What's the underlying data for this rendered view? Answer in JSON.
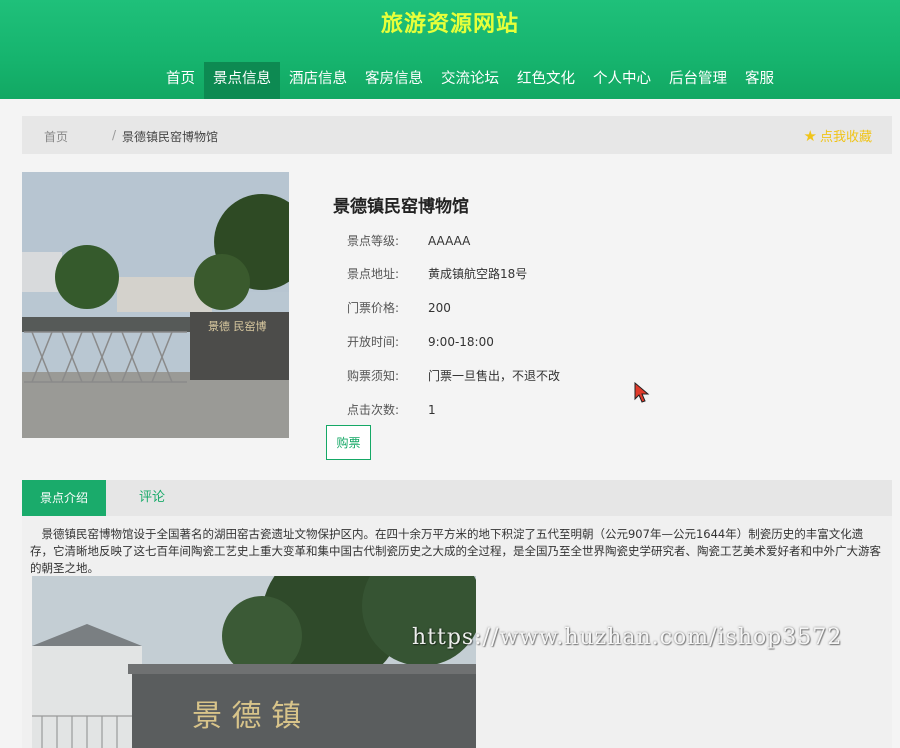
{
  "site": {
    "title": "旅游资源网站"
  },
  "nav": [
    {
      "label": "首页"
    },
    {
      "label": "景点信息"
    },
    {
      "label": "酒店信息"
    },
    {
      "label": "客房信息"
    },
    {
      "label": "交流论坛"
    },
    {
      "label": "红色文化"
    },
    {
      "label": "个人中心"
    },
    {
      "label": "后台管理"
    },
    {
      "label": "客服"
    }
  ],
  "nav_active": "景点信息",
  "breadcrumb": {
    "home": "首页",
    "separator": "/",
    "current": "景德镇民窑博物馆"
  },
  "favorite": {
    "label": "点我收藏",
    "icon": "star-icon"
  },
  "attraction": {
    "name": "景德镇民窑博物馆",
    "fields": [
      {
        "label": "景点等级:",
        "value": "AAAAA"
      },
      {
        "label": "景点地址:",
        "value": "黄成镇航空路18号"
      },
      {
        "label": "门票价格:",
        "value": "200"
      },
      {
        "label": "开放时间:",
        "value": "9:00-18:00"
      },
      {
        "label": "购票须知:",
        "value": "门票一旦售出，不退不改"
      },
      {
        "label": "点击次数:",
        "value": "1"
      }
    ],
    "buy_label": "购票",
    "photo_sign": "景德 民窑博"
  },
  "tabs": [
    {
      "label": "景点介绍"
    },
    {
      "label": "评论"
    }
  ],
  "description": "景德镇民窑博物馆设于全国著名的湖田窑古瓷遗址文物保护区内。在四十余万平方米的地下积淀了五代至明朝（公元907年—公元1644年）制瓷历史的丰富文化遗存，它清晰地反映了这七百年间陶瓷工艺史上重大变革和集中国古代制瓷历史之大成的全过程，是全国乃至全世界陶瓷史学研究者、陶瓷工艺美术爱好者和中外广大游客的朝圣之地。",
  "content_photo_sign": "景 德 镇",
  "watermark": "https://www.huzhan.com/ishop3572",
  "colors": {
    "brand": "#16b46e",
    "accent": "#e6ff3a",
    "active_nav": "#0d8a52",
    "star": "#f0c419"
  }
}
